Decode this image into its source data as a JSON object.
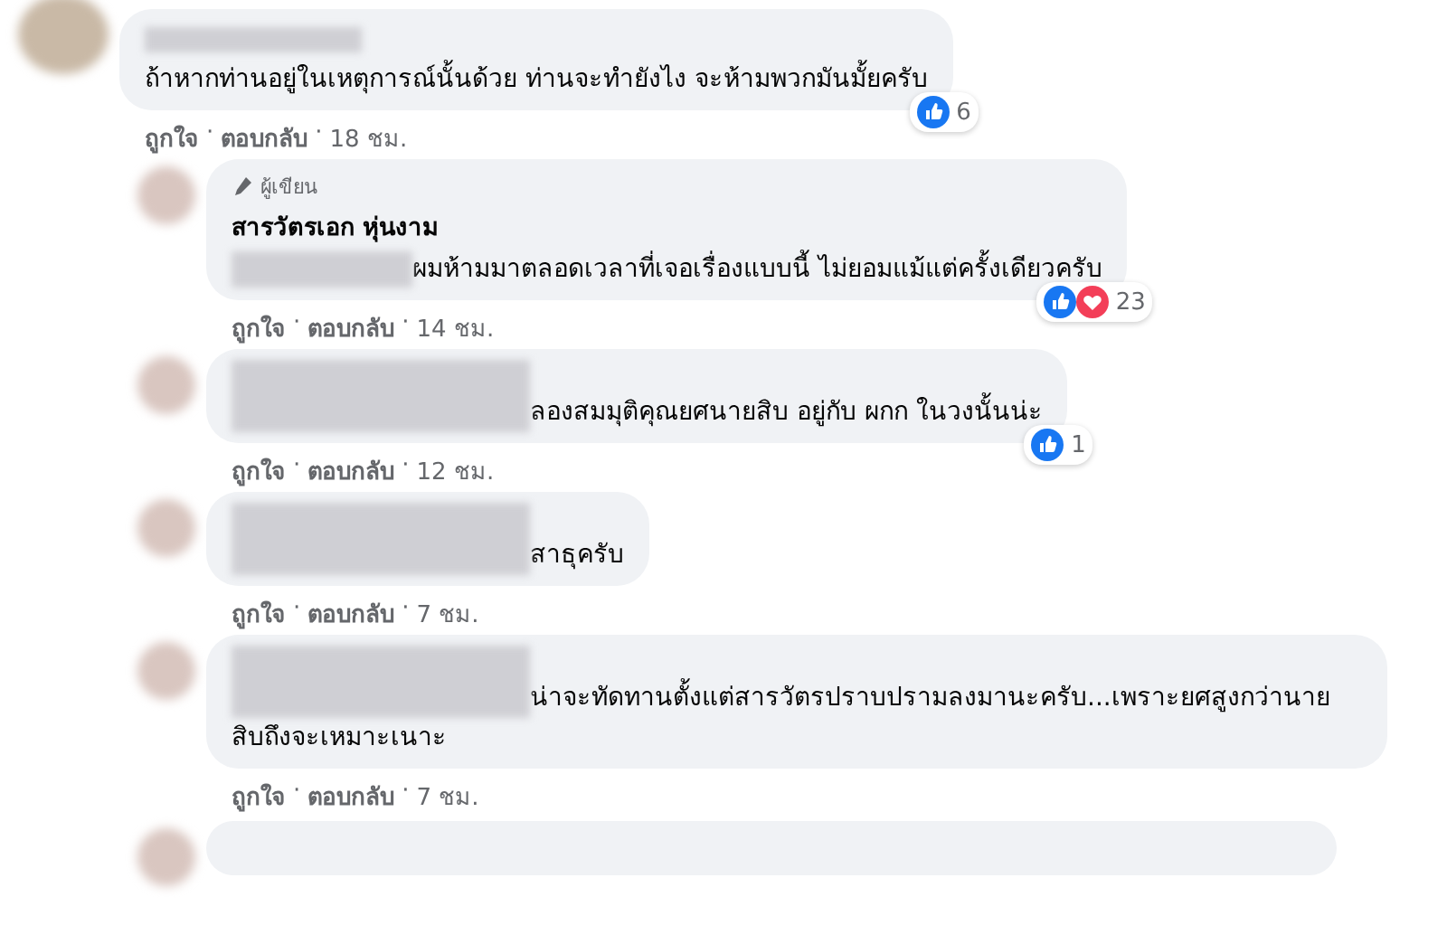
{
  "separator": "·",
  "thread": [
    {
      "kind": "name-line",
      "text": "ถ้าหากท่านอยู่ในเหตุการณ์นั้นด้วย ท่านจะทำยังไง จะห้ามพวกมันมั้ยครับ",
      "reactions": [
        {
          "kind": "like"
        }
      ],
      "reaction_count": "6",
      "actions": [
        "ถูกใจ",
        "ตอบกลับ"
      ],
      "time": "18 ชม.",
      "children": [
        {
          "badge": "ผู้เขียน",
          "author": "สารวัตรเอก หุ่นงาม",
          "kind": "inline",
          "text": "ผมห้ามมาตลอดเวลาที่เจอเรื่องแบบนี้ ไม่ยอมแม้แต่ครั้งเดียวครับ",
          "reactions": [
            {
              "kind": "like"
            },
            {
              "kind": "love"
            }
          ],
          "reaction_count": "23",
          "actions": [
            "ถูกใจ",
            "ตอบกลับ"
          ],
          "time": "14 ชม."
        },
        {
          "kind": "two-line",
          "text": "ลองสมมุติคุณยศนายสิบ อยู่กับ ผกก ในวงนั้นน่ะ",
          "reactions": [
            {
              "kind": "like"
            }
          ],
          "reaction_count": "1",
          "actions": [
            "ถูกใจ",
            "ตอบกลับ"
          ],
          "time": "12 ชม."
        },
        {
          "kind": "two-line",
          "text": "สาธุครับ",
          "actions": [
            "ถูกใจ",
            "ตอบกลับ"
          ],
          "time": "7 ชม."
        },
        {
          "kind": "two-line",
          "text": "น่าจะทัดทานตั้งแต่สารวัตรปราบปรามลงมานะครับ...เพราะยศสูงกว่านายสิบถึงจะเหมาะเนาะ",
          "actions": [
            "ถูกใจ",
            "ตอบกลับ"
          ],
          "time": "7 ชม."
        }
      ]
    }
  ],
  "more_below": true
}
